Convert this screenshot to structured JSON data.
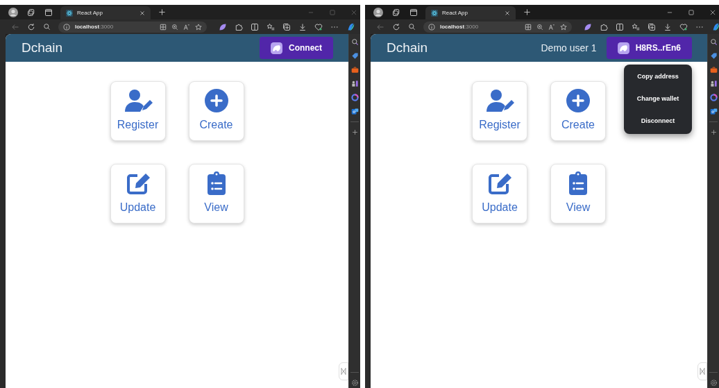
{
  "windows": [
    {
      "focused": false,
      "tab": {
        "title": "React App"
      },
      "address": {
        "host": "localhost",
        "port": ":3000"
      },
      "app": {
        "brand": "Dchain",
        "wallet_button": "Connect",
        "tiles": [
          {
            "kind": "register",
            "label": "Register"
          },
          {
            "kind": "create",
            "label": "Create"
          },
          {
            "kind": "update",
            "label": "Update"
          },
          {
            "kind": "view",
            "label": "View"
          }
        ]
      }
    },
    {
      "focused": true,
      "tab": {
        "title": "React App"
      },
      "address": {
        "host": "localhost",
        "port": ":3000"
      },
      "app": {
        "brand": "Dchain",
        "user": "Demo user 1",
        "wallet_button": "H8RS..rEn6",
        "tiles": [
          {
            "kind": "register",
            "label": "Register"
          },
          {
            "kind": "create",
            "label": "Create"
          },
          {
            "kind": "update",
            "label": "Update"
          },
          {
            "kind": "view",
            "label": "View"
          }
        ],
        "menu": {
          "items": [
            "Copy address",
            "Change wallet",
            "Disconnect"
          ]
        }
      }
    }
  ]
}
